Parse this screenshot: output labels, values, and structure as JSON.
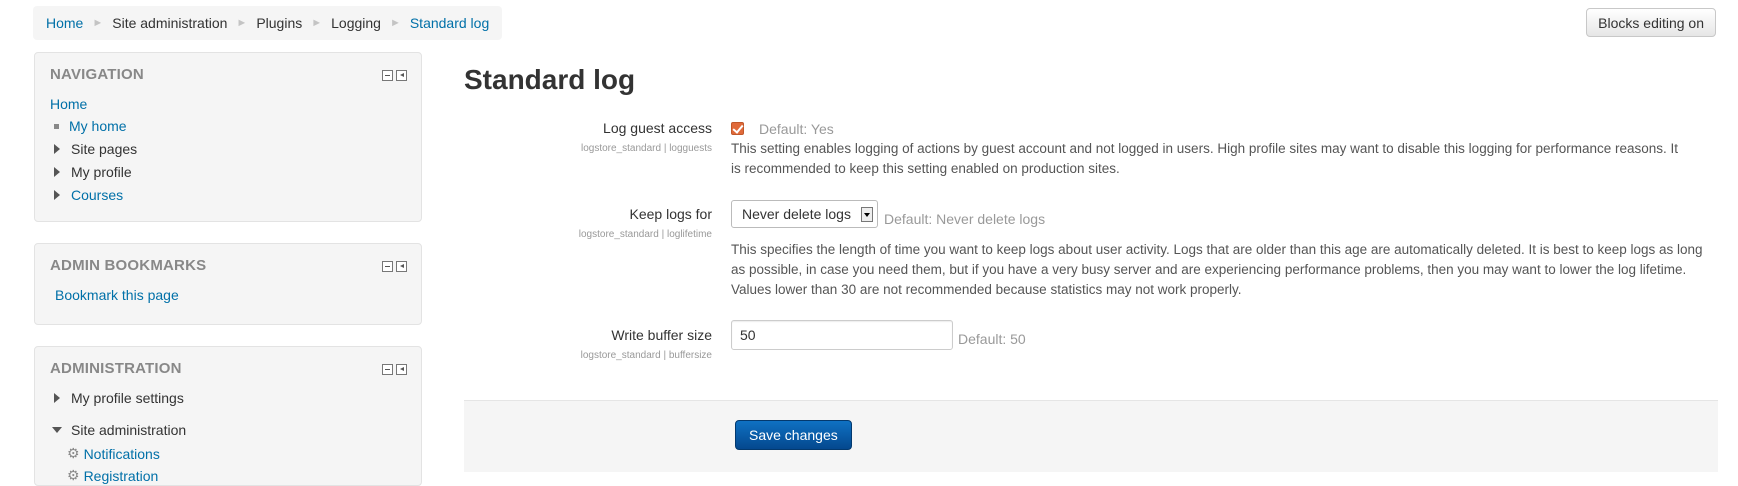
{
  "breadcrumb": {
    "items": [
      "Home",
      "Site administration",
      "Plugins",
      "Logging",
      "Standard log"
    ],
    "separator": "►"
  },
  "header": {
    "blocks_editing_label": "Blocks editing on"
  },
  "sidebar": {
    "navigation": {
      "title": "NAVIGATION",
      "home": "Home",
      "items": [
        "My home",
        "Site pages",
        "My profile",
        "Courses"
      ]
    },
    "admin_bookmarks": {
      "title": "ADMIN BOOKMARKS",
      "bookmark_link": "Bookmark this page"
    },
    "administration": {
      "title": "ADMINISTRATION",
      "items": [
        "My profile settings",
        "Site administration"
      ],
      "sub_items": [
        "Notifications",
        "Registration"
      ]
    }
  },
  "main": {
    "title": "Standard log",
    "settings": [
      {
        "label": "Log guest access",
        "key": "logstore_standard | logguests",
        "checked": true,
        "default": "Default: Yes",
        "description": "This setting enables logging of actions by guest account and not logged in users. High profile sites may want to disable this logging for performance reasons. It is recommended to keep this setting enabled on production sites."
      },
      {
        "label": "Keep logs for",
        "key": "logstore_standard | loglifetime",
        "value": "Never delete logs",
        "default": "Default: Never delete logs",
        "description": "This specifies the length of time you want to keep logs about user activity. Logs that are older than this age are automatically deleted. It is best to keep logs as long as possible, in case you need them, but if you have a very busy server and are experiencing performance problems, then you may want to lower the log lifetime. Values lower than 30 are not recommended because statistics may not work properly."
      },
      {
        "label": "Write buffer size",
        "key": "logstore_standard | buffersize",
        "value": "50",
        "default": "Default: 50"
      }
    ],
    "save_label": "Save changes"
  },
  "colors": {
    "link": "#0070a8",
    "save_button": "#0a5ba8",
    "checkbox": "#e06a3a"
  }
}
